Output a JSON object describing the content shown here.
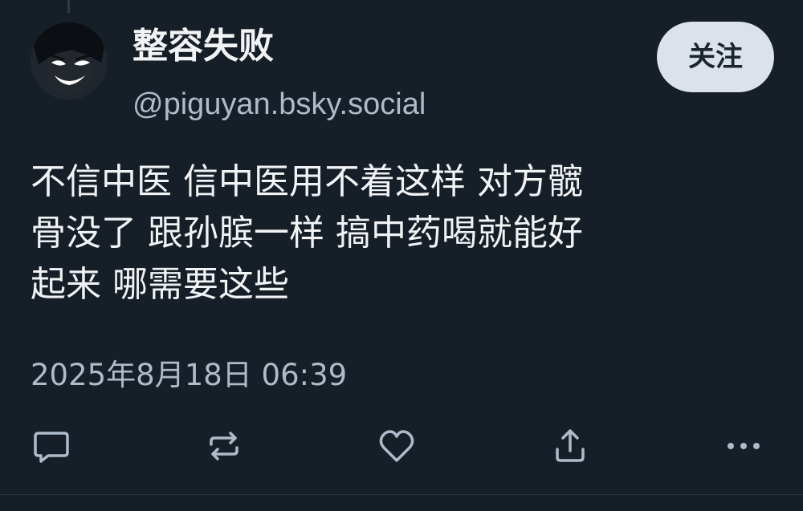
{
  "post": {
    "author": {
      "display_name": "整容失败",
      "handle": "@piguyan.bsky.social",
      "avatar_icon": "dark-anime-face-avatar"
    },
    "follow_label": "关注",
    "text": "不信中医 信中医用不着这样 对方髋\n骨没了 跟孙膑一样 搞中药喝就能好\n起来 哪需要这些",
    "timestamp": "2025年8月18日 06:39"
  },
  "actions": [
    {
      "name": "reply",
      "icon": "reply-icon"
    },
    {
      "name": "repost",
      "icon": "repost-icon"
    },
    {
      "name": "like",
      "icon": "heart-icon"
    },
    {
      "name": "share",
      "icon": "share-icon"
    },
    {
      "name": "more",
      "icon": "more-icon"
    }
  ],
  "colors": {
    "background": "#161e27",
    "text": "#f1f3f5",
    "secondary_text": "#aebbc9",
    "follow_button_bg": "#dce2ea",
    "icon": "#aebbc9"
  }
}
